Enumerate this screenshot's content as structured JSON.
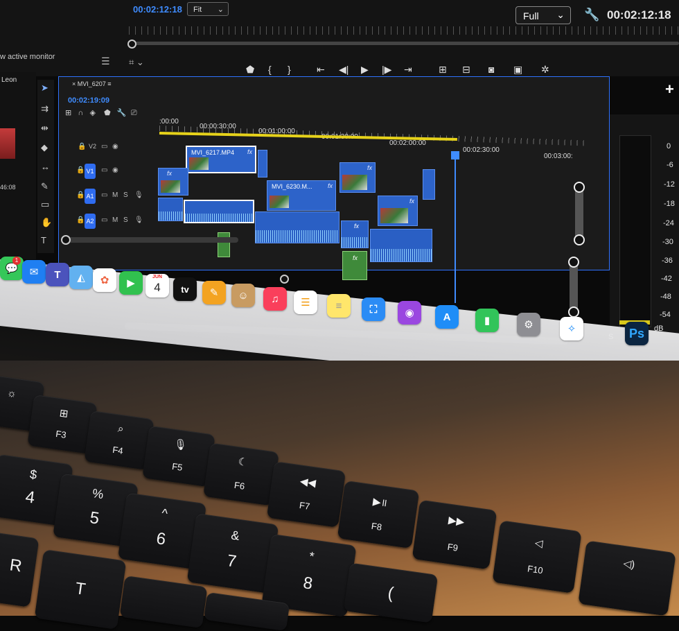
{
  "monitor": {
    "timecode_left": "00:02:12:18",
    "fit_select": "Fit",
    "quality_select": "Full",
    "timecode_right": "00:02:12:18",
    "side_label": "w active monitor",
    "panel_label": "Leon"
  },
  "timeline": {
    "sequence_name": "MVI_6207",
    "timecode": "00:02:19:09",
    "ruler_labels": [
      ":00:00",
      "00:00:30:00",
      "00:01:00:00",
      "00:01:30:00",
      "00:02:00:00",
      "00:02:30:00",
      "00:03:00:"
    ],
    "side_numbers": [
      "46:08"
    ],
    "tracks": [
      {
        "tag": "V2",
        "letter": "V2"
      },
      {
        "tag": "V1",
        "letter": "V1"
      },
      {
        "tag": "A1",
        "letter": "A1"
      },
      {
        "tag": "A2",
        "letter": "A2"
      }
    ],
    "track_letters": {
      "m": "M",
      "s": "S"
    },
    "clips": {
      "clip1": "MVI_6217.MP4",
      "clip2": "MVI_6230.M...",
      "fx": "fx"
    }
  },
  "meter": {
    "labels": [
      "0",
      "-6",
      "-12",
      "-18",
      "-24",
      "-30",
      "-36",
      "-42",
      "-48",
      "-54",
      "dB"
    ],
    "solo_labels": [
      "S",
      "S"
    ]
  },
  "dock": {
    "messages_badge": "1",
    "calendar_month": "JUN",
    "calendar_day": "4",
    "tv_label": "tv",
    "ps_label": "Ps",
    "icons": [
      "messages-icon",
      "mail-icon",
      "teams-icon",
      "maps-icon",
      "photos-icon",
      "facetime-icon",
      "calendar-icon",
      "tv-icon",
      "pages-icon",
      "contacts-icon",
      "music-icon",
      "reminders-icon",
      "notes-icon",
      "keynote-icon",
      "podcasts-icon",
      "appstore-icon",
      "numbers-icon",
      "settings-icon",
      "safari-icon",
      "photoshop-icon"
    ]
  },
  "keyboard": {
    "fn_keys": [
      {
        "top": "☼",
        "bottom": ""
      },
      {
        "top": "⊞",
        "bottom": "F3"
      },
      {
        "top": "⌕",
        "bottom": "F4"
      },
      {
        "top": "🎙",
        "bottom": "F5"
      },
      {
        "top": "☾",
        "bottom": "F6"
      },
      {
        "top": "◀◀",
        "bottom": "F7"
      },
      {
        "top": "▶॥",
        "bottom": "F8"
      },
      {
        "top": "▶▶",
        "bottom": "F9"
      },
      {
        "top": "◁",
        "bottom": "F10"
      },
      {
        "top": "◁)",
        "bottom": ""
      }
    ],
    "num_keys": [
      {
        "top": "$",
        "bottom": "4"
      },
      {
        "top": "%",
        "bottom": "5"
      },
      {
        "top": "^",
        "bottom": "6"
      },
      {
        "top": "&",
        "bottom": "7"
      },
      {
        "top": "*",
        "bottom": "8"
      }
    ],
    "letter_keys": [
      "R",
      "T",
      "("
    ]
  }
}
